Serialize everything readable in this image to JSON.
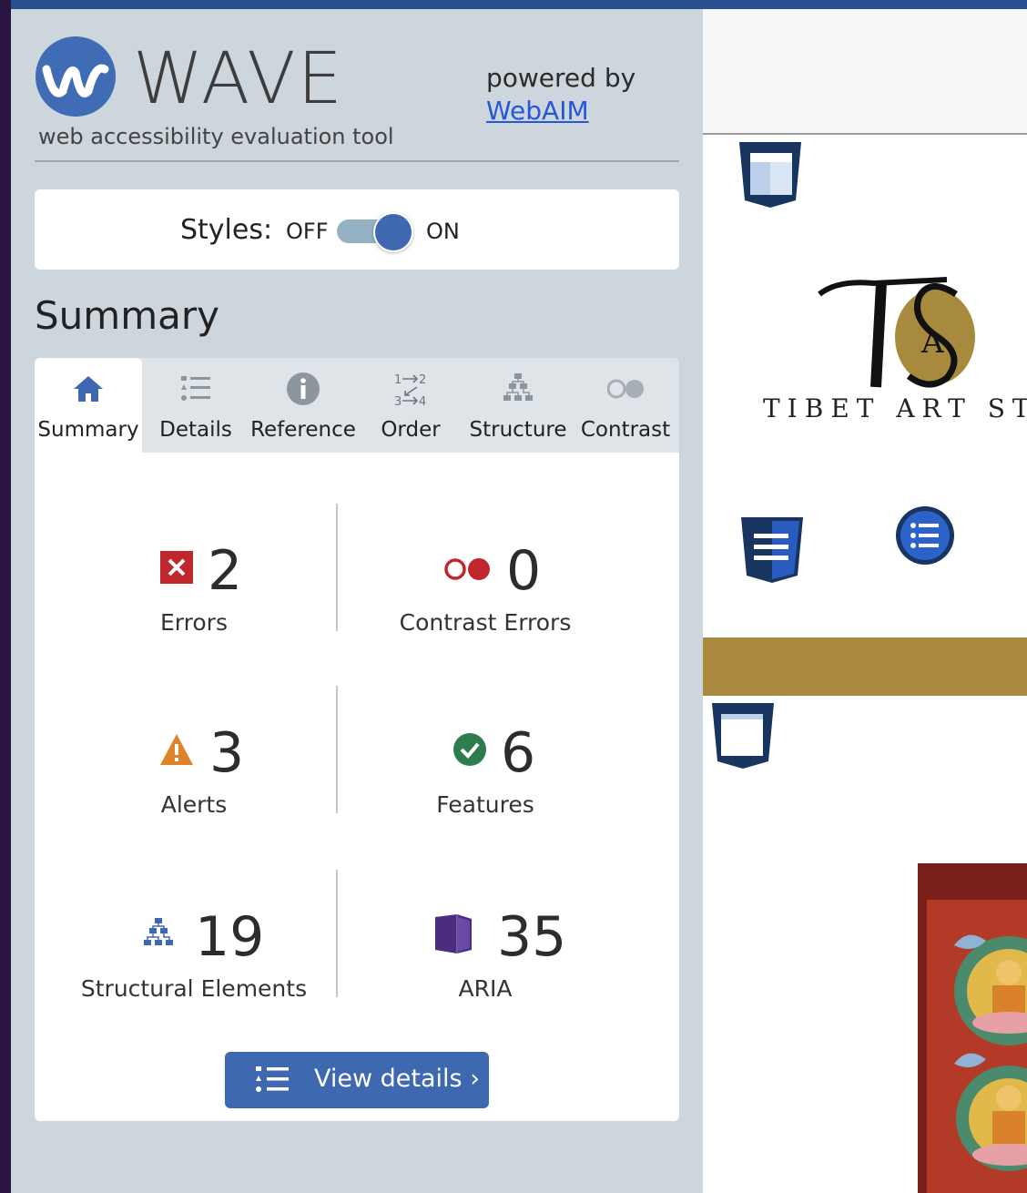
{
  "header": {
    "logo_glyph": "W",
    "title": "WAVE",
    "subtitle": "web accessibility evaluation tool",
    "powered_by": "powered by",
    "powered_link": "WebAIM"
  },
  "styles_toggle": {
    "label": "Styles:",
    "off_label": "OFF",
    "on_label": "ON",
    "state": "ON"
  },
  "summary_heading": "Summary",
  "tabs": [
    {
      "label": "Summary",
      "icon": "home-icon",
      "active": true
    },
    {
      "label": "Details",
      "icon": "list-icon",
      "active": false
    },
    {
      "label": "Reference",
      "icon": "info-icon",
      "active": false
    },
    {
      "label": "Order",
      "icon": "order-icon",
      "active": false
    },
    {
      "label": "Structure",
      "icon": "structure-icon",
      "active": false
    },
    {
      "label": "Contrast",
      "icon": "contrast-icon",
      "active": false
    }
  ],
  "stats": {
    "errors": {
      "count": "2",
      "label": "Errors",
      "icon": "error-icon"
    },
    "contrast_errors": {
      "count": "0",
      "label": "Contrast Errors",
      "icon": "contrast-error-icon"
    },
    "alerts": {
      "count": "3",
      "label": "Alerts",
      "icon": "alert-icon"
    },
    "features": {
      "count": "6",
      "label": "Features",
      "icon": "feature-check-icon"
    },
    "structural": {
      "count": "19",
      "label": "Structural Elements",
      "icon": "structure-icon"
    },
    "aria": {
      "count": "35",
      "label": "ARIA",
      "icon": "aria-icon"
    }
  },
  "view_details_button": "View details ›",
  "page_preview": {
    "logo_letters": "TSA",
    "logo_text": "TIBET ART STO"
  },
  "colors": {
    "accent": "#3e68b0",
    "error": "#c0272d",
    "alert": "#e0822a",
    "feature": "#2e7d4f",
    "aria": "#4b2d7f",
    "gold": "#a98a3e"
  }
}
